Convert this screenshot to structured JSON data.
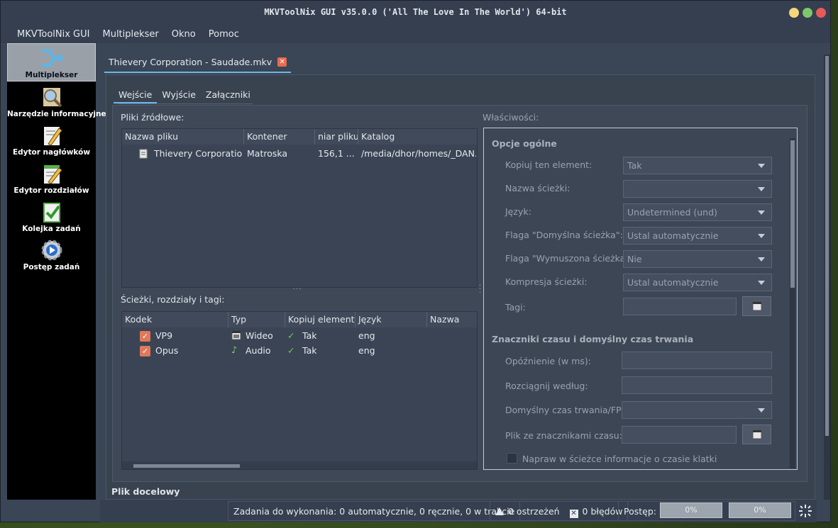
{
  "window": {
    "title": "MKVToolNix GUI v35.0.0 ('All The Love In The World') 64-bit",
    "buttons": {
      "minimize_color": "#f4d77a",
      "maximize_color": "#7dc86b",
      "close_color": "#e85a5a"
    }
  },
  "menubar": [
    "MKVToolNix GUI",
    "Multiplekser",
    "Okno",
    "Pomoc"
  ],
  "sidebar": {
    "items": [
      {
        "label": "Multiplekser",
        "icon": "multiplexer-icon",
        "active": true
      },
      {
        "label": "Narzędzie informacyjne",
        "icon": "magnifier-icon"
      },
      {
        "label": "Edytor nagłówków",
        "icon": "header-editor-icon"
      },
      {
        "label": "Edytor rozdziałów",
        "icon": "chapter-editor-icon"
      },
      {
        "label": "Kolejka zadań",
        "icon": "job-queue-icon"
      },
      {
        "label": "Postęp zadań",
        "icon": "job-progress-icon"
      }
    ]
  },
  "doc_tab": {
    "label": "Thievery Corporation - Saudade.mkv"
  },
  "tabs": [
    "Wejście",
    "Wyjście",
    "Załączniki"
  ],
  "source_files": {
    "label": "Pliki źródłowe:",
    "columns": [
      "Nazwa pliku",
      "Kontener",
      "niar pliku",
      "Katalog"
    ],
    "rows": [
      {
        "name": "Thievery Corporatio...",
        "container": "Matroska",
        "size": "156,1 ...",
        "dir": "/media/dhor/homes/_DAN..."
      }
    ]
  },
  "tracks": {
    "label": "Ścieżki, rozdziały i tagi:",
    "columns": [
      "Kodek",
      "Typ",
      "Kopiuj element",
      "Język",
      "Nazwa"
    ],
    "rows": [
      {
        "codec": "VP9",
        "type": "Wideo",
        "copy": "Tak",
        "lang": "eng"
      },
      {
        "codec": "Opus",
        "type": "Audio",
        "copy": "Tak",
        "lang": "eng"
      }
    ]
  },
  "properties": {
    "label": "Właściwości:",
    "general_header": "Opcje ogólne",
    "copy_item": {
      "label": "Kopiuj ten element:",
      "value": "Tak"
    },
    "track_name": {
      "label": "Nazwa ścieżki:",
      "value": ""
    },
    "language": {
      "label": "Język:",
      "value": "Undetermined (und)"
    },
    "default_flag": {
      "label": "Flaga \"Domyślna ścieżka\":",
      "value": "Ustal automatycznie"
    },
    "forced_flag": {
      "label": "Flaga \"Wymuszona ścieżka\":",
      "value": "Nie"
    },
    "compression": {
      "label": "Kompresja ścieżki:",
      "value": "Ustal automatycznie"
    },
    "tags": {
      "label": "Tagi:"
    },
    "timing_header": "Znaczniki czasu i domyślny czas trwania",
    "delay": {
      "label": "Opóźnienie (w ms):"
    },
    "stretch": {
      "label": "Rozciągnij według:"
    },
    "default_duration": {
      "label": "Domyślny czas trwania/FPS:"
    },
    "timestamps_file": {
      "label": "Plik ze znacznikami czasu:"
    },
    "fix_bitstream": {
      "label": "Napraw w ścieżce informacje o czasie klatki"
    }
  },
  "destination": {
    "label": "Plik docelowy"
  },
  "statusbar": {
    "jobs": "Zadania do wykonania:  0 automatycznie, 0 ręcznie, 0 w trakcie",
    "warnings": "0 ostrzeżeń",
    "errors": "0 błędów",
    "progress_label": "Postęp:",
    "progress1": "0%",
    "progress2": "0%"
  }
}
